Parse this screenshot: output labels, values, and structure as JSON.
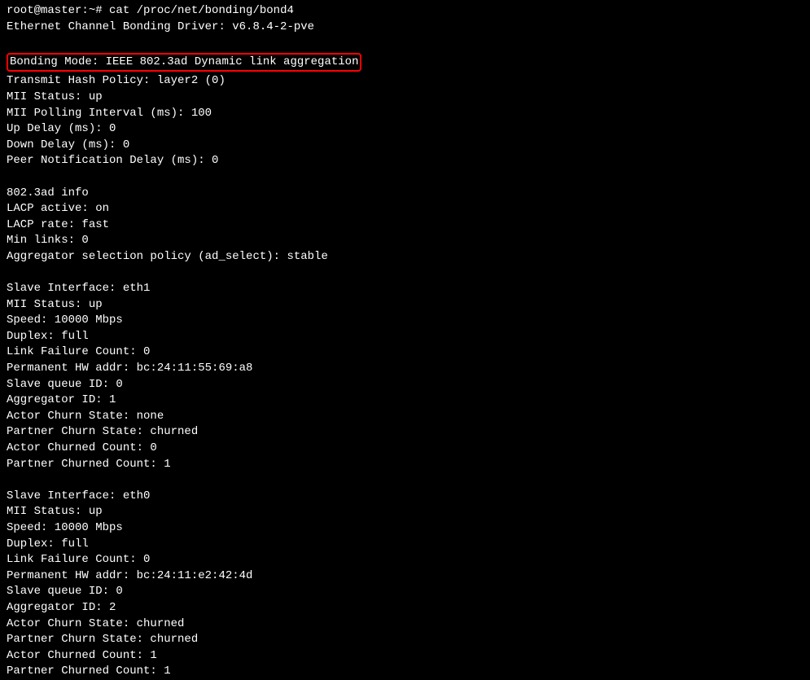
{
  "prompt": "root@master:~# ",
  "command": "cat /proc/net/bonding/bond4",
  "driver_line": "Ethernet Channel Bonding Driver: v6.8.4-2-pve",
  "highlighted": "Bonding Mode: IEEE 802.3ad Dynamic link aggregation",
  "main_block": [
    "Transmit Hash Policy: layer2 (0)",
    "MII Status: up",
    "MII Polling Interval (ms): 100",
    "Up Delay (ms): 0",
    "Down Delay (ms): 0",
    "Peer Notification Delay (ms): 0"
  ],
  "ad_info_block": [
    "802.3ad info",
    "LACP active: on",
    "LACP rate: fast",
    "Min links: 0",
    "Aggregator selection policy (ad_select): stable"
  ],
  "slave1_block": [
    "Slave Interface: eth1",
    "MII Status: up",
    "Speed: 10000 Mbps",
    "Duplex: full",
    "Link Failure Count: 0",
    "Permanent HW addr: bc:24:11:55:69:a8",
    "Slave queue ID: 0",
    "Aggregator ID: 1",
    "Actor Churn State: none",
    "Partner Churn State: churned",
    "Actor Churned Count: 0",
    "Partner Churned Count: 1"
  ],
  "slave2_block": [
    "Slave Interface: eth0",
    "MII Status: up",
    "Speed: 10000 Mbps",
    "Duplex: full",
    "Link Failure Count: 0",
    "Permanent HW addr: bc:24:11:e2:42:4d",
    "Slave queue ID: 0",
    "Aggregator ID: 2",
    "Actor Churn State: churned",
    "Partner Churn State: churned",
    "Actor Churned Count: 1",
    "Partner Churned Count: 1"
  ]
}
